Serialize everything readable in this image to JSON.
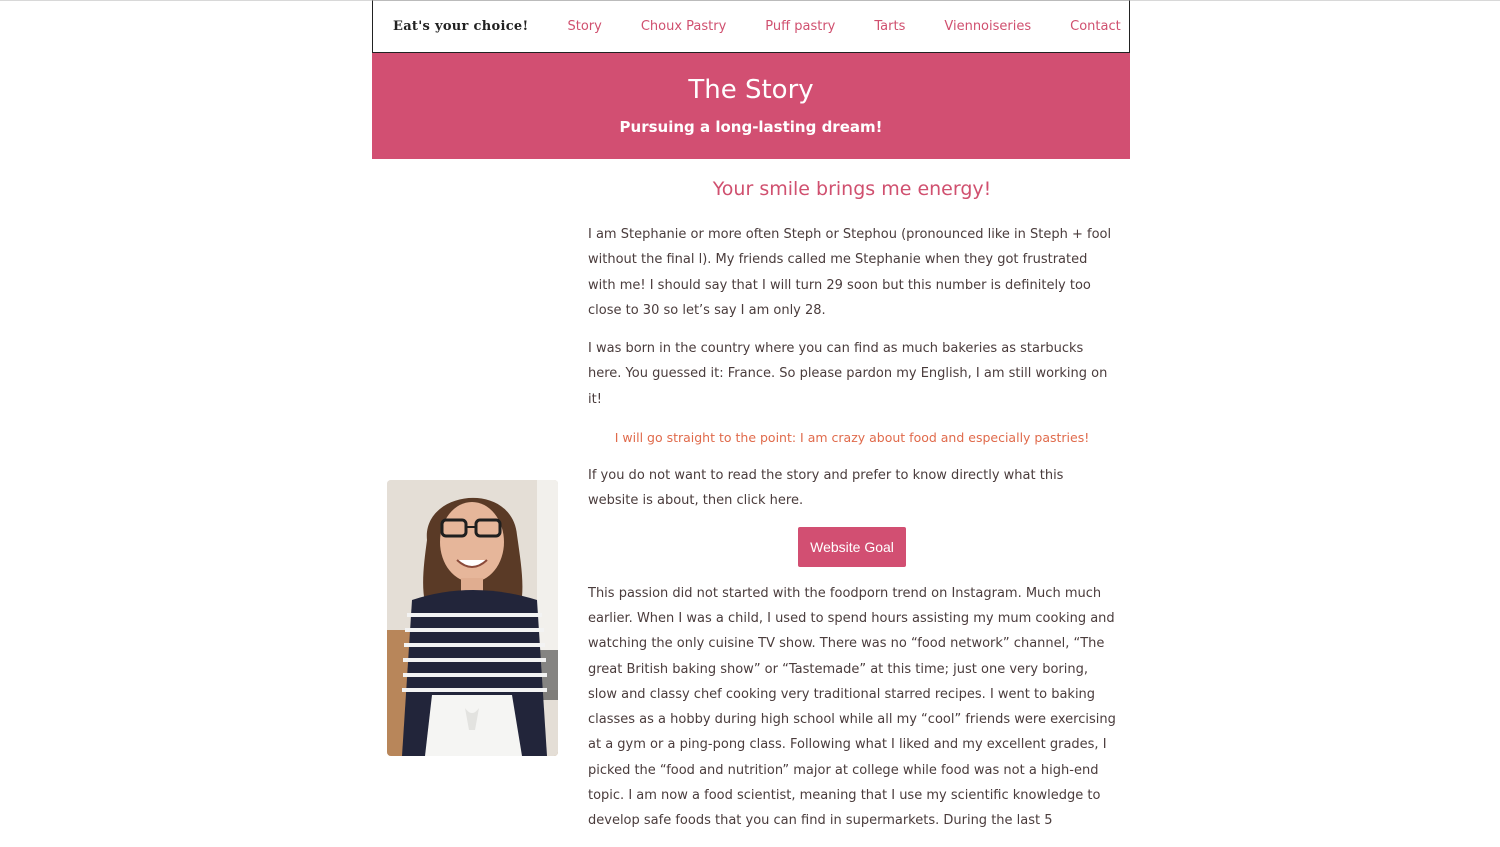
{
  "nav": {
    "brand": "Eat's your choice!",
    "items": [
      "Story",
      "Choux Pastry",
      "Puff pastry",
      "Tarts",
      "Viennoiseries",
      "Contact"
    ]
  },
  "hero": {
    "title": "The Story",
    "subtitle": "Pursuing a long-lasting dream!"
  },
  "main": {
    "heading": "Your smile brings me energy!",
    "paragraphs": [
      "I am Stephanie or more often Steph or Stephou (pronounced like in Steph + fool without the final l). My friends called me Stephanie when they got frustrated with me! I should say that I will turn 29 soon but this number is definitely too close to 30 so let’s say I am only 28.",
      "I was born in the country where you can find as much bakeries as starbucks here. You guessed it: France. So please pardon my English, I am still working on it!"
    ],
    "highlight": "I will go straight to the point: I am crazy about food and especially pastries!",
    "intro_goal": "If you do not want to read the story and prefer to know directly what this website is about, then click here.",
    "button_label": "Website Goal",
    "story": "This passion did not started with the foodporn trend on Instagram. Much much earlier. When I was a child, I used to spend hours assisting my mum cooking and watching the only cuisine TV show. There was no “food network” channel, “The great British baking show” or “Tastemade” at this time; just one very boring, slow and classy chef cooking very traditional starred recipes. I went to baking classes as a hobby during high school while all my “cool” friends were exercising at a gym or a ping-pong class. Following what I liked and my excellent grades, I picked the “food and nutrition” major at college while food was not a high-end topic. I am now a food scientist, meaning that I use my scientific knowledge to develop safe foods that you can find in supermarkets. During the last 5"
  },
  "colors": {
    "accent": "#d24f72",
    "highlight": "#e06a4b",
    "text": "#4a3c3c"
  }
}
